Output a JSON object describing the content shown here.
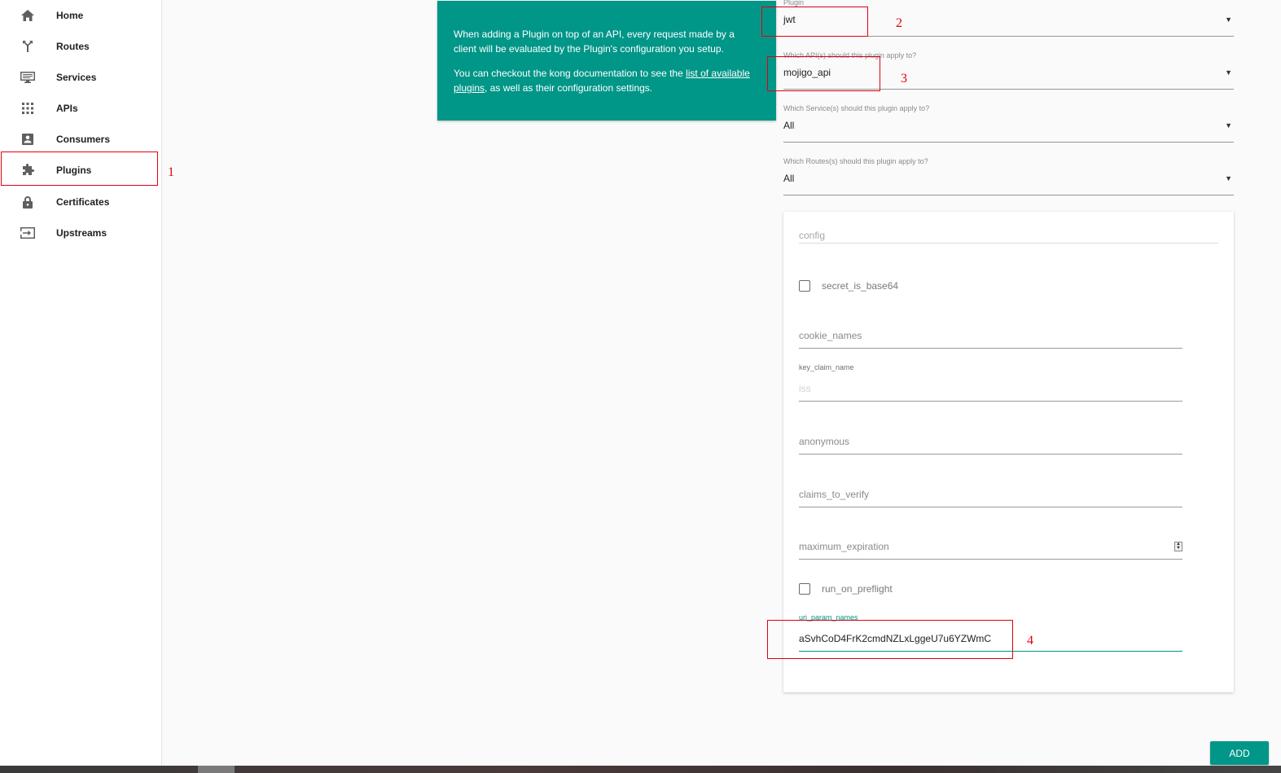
{
  "sidebar": {
    "items": [
      {
        "label": "Home",
        "icon": "home-icon"
      },
      {
        "label": "Routes",
        "icon": "routes-icon"
      },
      {
        "label": "Services",
        "icon": "services-icon"
      },
      {
        "label": "APIs",
        "icon": "apis-icon"
      },
      {
        "label": "Consumers",
        "icon": "consumers-icon"
      },
      {
        "label": "Plugins",
        "icon": "plugins-icon"
      },
      {
        "label": "Certificates",
        "icon": "certificates-icon"
      },
      {
        "label": "Upstreams",
        "icon": "upstreams-icon"
      }
    ]
  },
  "annotations": [
    "1",
    "2",
    "3",
    "4"
  ],
  "info": {
    "p1": "When adding a Plugin on top of an API, every request made by a client will be evaluated by the Plugin's configuration you setup.",
    "p2_pre": "You can checkout the kong documentation to see the ",
    "p2_link": "list of available plugins",
    "p2_post": ", as well as their configuration settings."
  },
  "form": {
    "plugin": {
      "label": "Plugin",
      "value": "jwt"
    },
    "api": {
      "label": "Which API(s) should this plugin apply to?",
      "value": "mojigo_api"
    },
    "service": {
      "label": "Which Service(s) should this plugin apply to?",
      "value": "All"
    },
    "route": {
      "label": "Which Routes(s) should this plugin apply to?",
      "value": "All"
    }
  },
  "config": {
    "title": "config",
    "secret_is_base64": "secret_is_base64",
    "cookie_names": "cookie_names",
    "key_claim_name_label": "key_claim_name",
    "key_claim_name_placeholder": "iss",
    "anonymous": "anonymous",
    "claims_to_verify": "claims_to_verify",
    "maximum_expiration": "maximum_expiration",
    "run_on_preflight": "run_on_preflight",
    "uri_param_names_label": "uri_param_names",
    "uri_param_names_value": "aSvhCoD4FrK2cmdNZLxLggeU7u6YZWmC"
  },
  "buttons": {
    "add": "ADD"
  },
  "colors": {
    "accent": "#009688",
    "annotation": "#e0000f"
  }
}
